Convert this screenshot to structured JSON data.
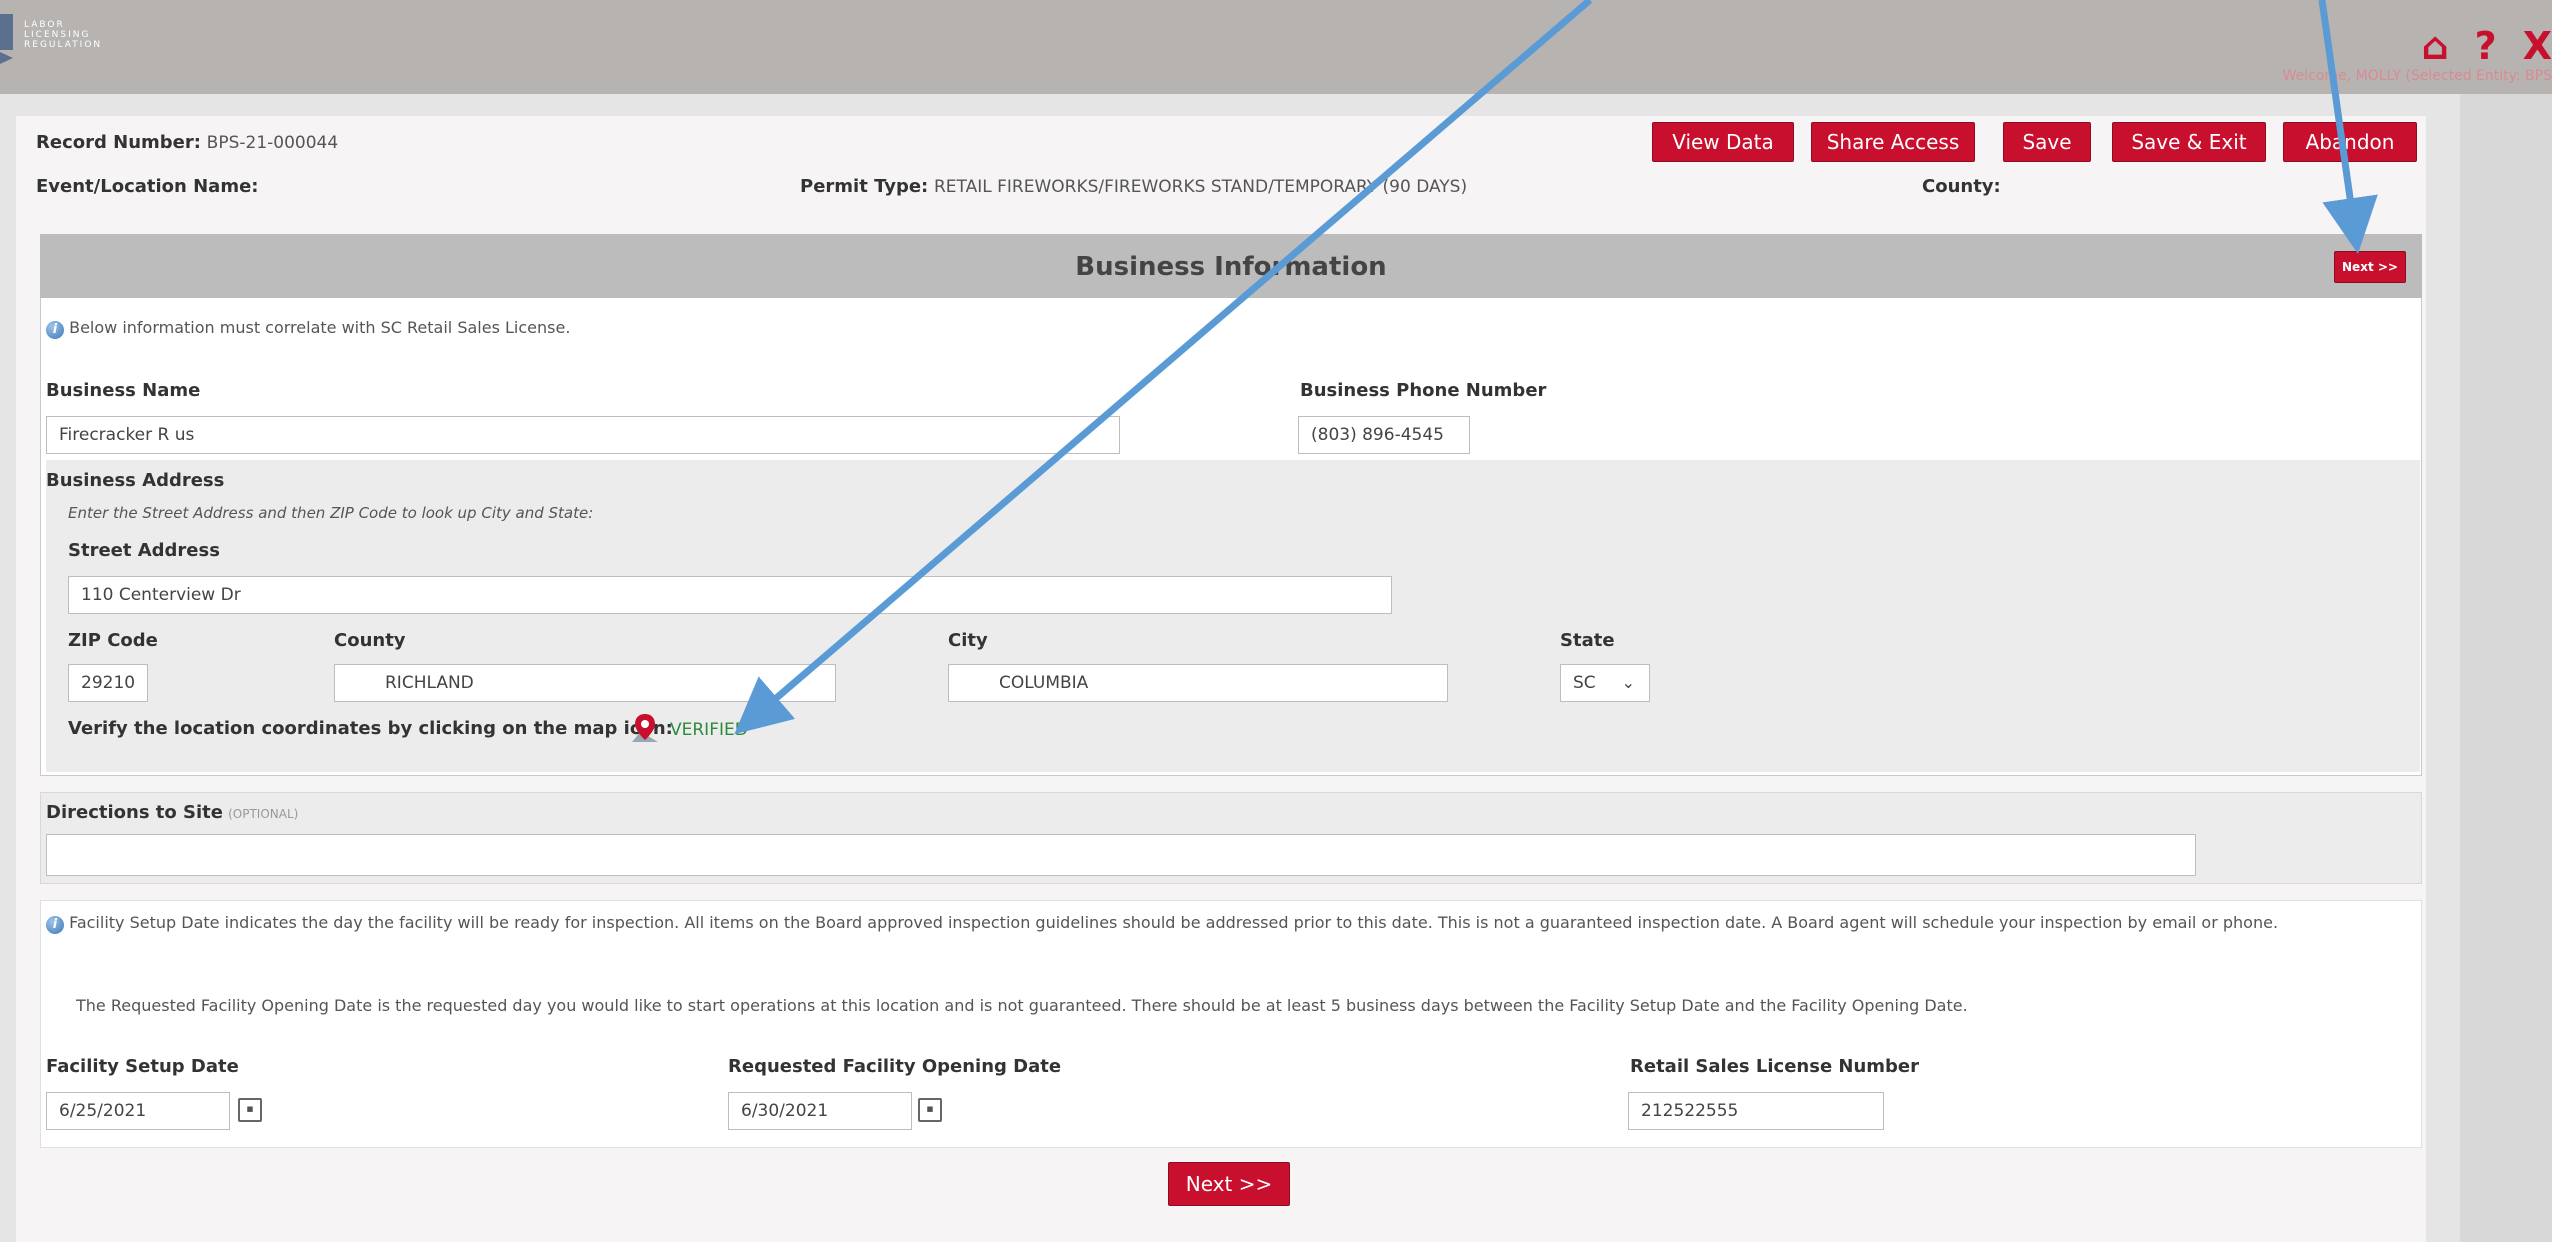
{
  "header": {
    "org_lines": [
      "LABOR",
      "LICENSING",
      "REGULATION"
    ],
    "welcome": "Welcome, MOLLY (Selected Entity: BPS"
  },
  "record": {
    "record_number_label": "Record Number:",
    "record_number": "BPS-21-000044",
    "event_label": "Event/Location Name:",
    "permit_type_label": "Permit Type:",
    "permit_type": "RETAIL FIREWORKS/FIREWORKS STAND/TEMPORARY (90 DAYS)",
    "county_label": "County:"
  },
  "toolbar": {
    "view_data": "View Data",
    "share_access": "Share Access",
    "save": "Save",
    "save_exit": "Save & Exit",
    "abandon": "Abandon"
  },
  "business_info": {
    "title": "Business Information",
    "next_small": "Next >>",
    "note": "Below information must correlate with SC Retail Sales License.",
    "business_name_label": "Business Name",
    "business_name": "Firecracker R us",
    "phone_label": "Business Phone Number",
    "phone": "(803) 896-4545",
    "address_label": "Business Address",
    "address_hint": "Enter the Street Address and then ZIP Code to look up City and State:",
    "street_label": "Street Address",
    "street": "110 Centerview Dr",
    "zip_label": "ZIP Code",
    "zip": "29210",
    "county_label": "County",
    "county": "RICHLAND",
    "city_label": "City",
    "city": "COLUMBIA",
    "state_label": "State",
    "state": "SC",
    "verify_label": "Verify the location coordinates by clicking on the map icon:",
    "verified": "VERIFIED"
  },
  "directions": {
    "label": "Directions to Site",
    "optional": "(OPTIONAL)",
    "value": ""
  },
  "facility": {
    "note1": "Facility Setup Date indicates the day the facility will be ready for inspection. All items on the Board approved inspection guidelines should be addressed prior to this date. This is not a guaranteed inspection date. A Board agent will schedule your inspection by email or phone.",
    "note2": "The Requested Facility Opening Date is the requested day you would like to start operations at this location and is not guaranteed. There should be at least 5 business days between the Facility Setup Date and the Facility Opening Date.",
    "setup_label": "Facility Setup Date",
    "setup_date": "6/25/2021",
    "opening_label": "Requested Facility Opening Date",
    "opening_date": "6/30/2021",
    "license_label": "Retail Sales License Number",
    "license_number": "212522555"
  },
  "footer": {
    "next": "Next >>"
  },
  "colors": {
    "accent": "#c8102e",
    "arrow": "#5b9bd5",
    "verified": "#2e8b3d"
  }
}
